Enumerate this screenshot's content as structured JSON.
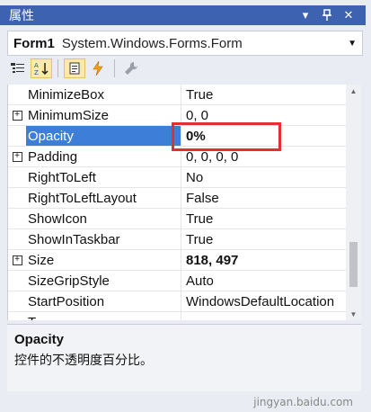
{
  "titlebar": {
    "title": "属性"
  },
  "object": {
    "name": "Form1",
    "type": "System.Windows.Forms.Form"
  },
  "properties": [
    {
      "name": "MinimizeBox",
      "value": "True",
      "expandable": false,
      "bold": false,
      "selected": false
    },
    {
      "name": "MinimumSize",
      "value": "0, 0",
      "expandable": true,
      "bold": false,
      "selected": false
    },
    {
      "name": "Opacity",
      "value": "0%",
      "expandable": false,
      "bold": true,
      "selected": true
    },
    {
      "name": "Padding",
      "value": "0, 0, 0, 0",
      "expandable": true,
      "bold": false,
      "selected": false
    },
    {
      "name": "RightToLeft",
      "value": "No",
      "expandable": false,
      "bold": false,
      "selected": false
    },
    {
      "name": "RightToLeftLayout",
      "value": "False",
      "expandable": false,
      "bold": false,
      "selected": false
    },
    {
      "name": "ShowIcon",
      "value": "True",
      "expandable": false,
      "bold": false,
      "selected": false
    },
    {
      "name": "ShowInTaskbar",
      "value": "True",
      "expandable": false,
      "bold": false,
      "selected": false
    },
    {
      "name": "Size",
      "value": "818, 497",
      "expandable": true,
      "bold": true,
      "selected": false
    },
    {
      "name": "SizeGripStyle",
      "value": "Auto",
      "expandable": false,
      "bold": false,
      "selected": false
    },
    {
      "name": "StartPosition",
      "value": "WindowsDefaultLocation",
      "expandable": false,
      "bold": false,
      "selected": false
    },
    {
      "name": "T",
      "value": "",
      "expandable": false,
      "bold": false,
      "selected": false
    }
  ],
  "description": {
    "title": "Opacity",
    "text": "控件的不透明度百分比。"
  },
  "watermark": "jingyan.baidu.com",
  "colors": {
    "titlebar": "#3d62b0",
    "selection": "#3d7ed8",
    "highlight": "#e23030"
  }
}
